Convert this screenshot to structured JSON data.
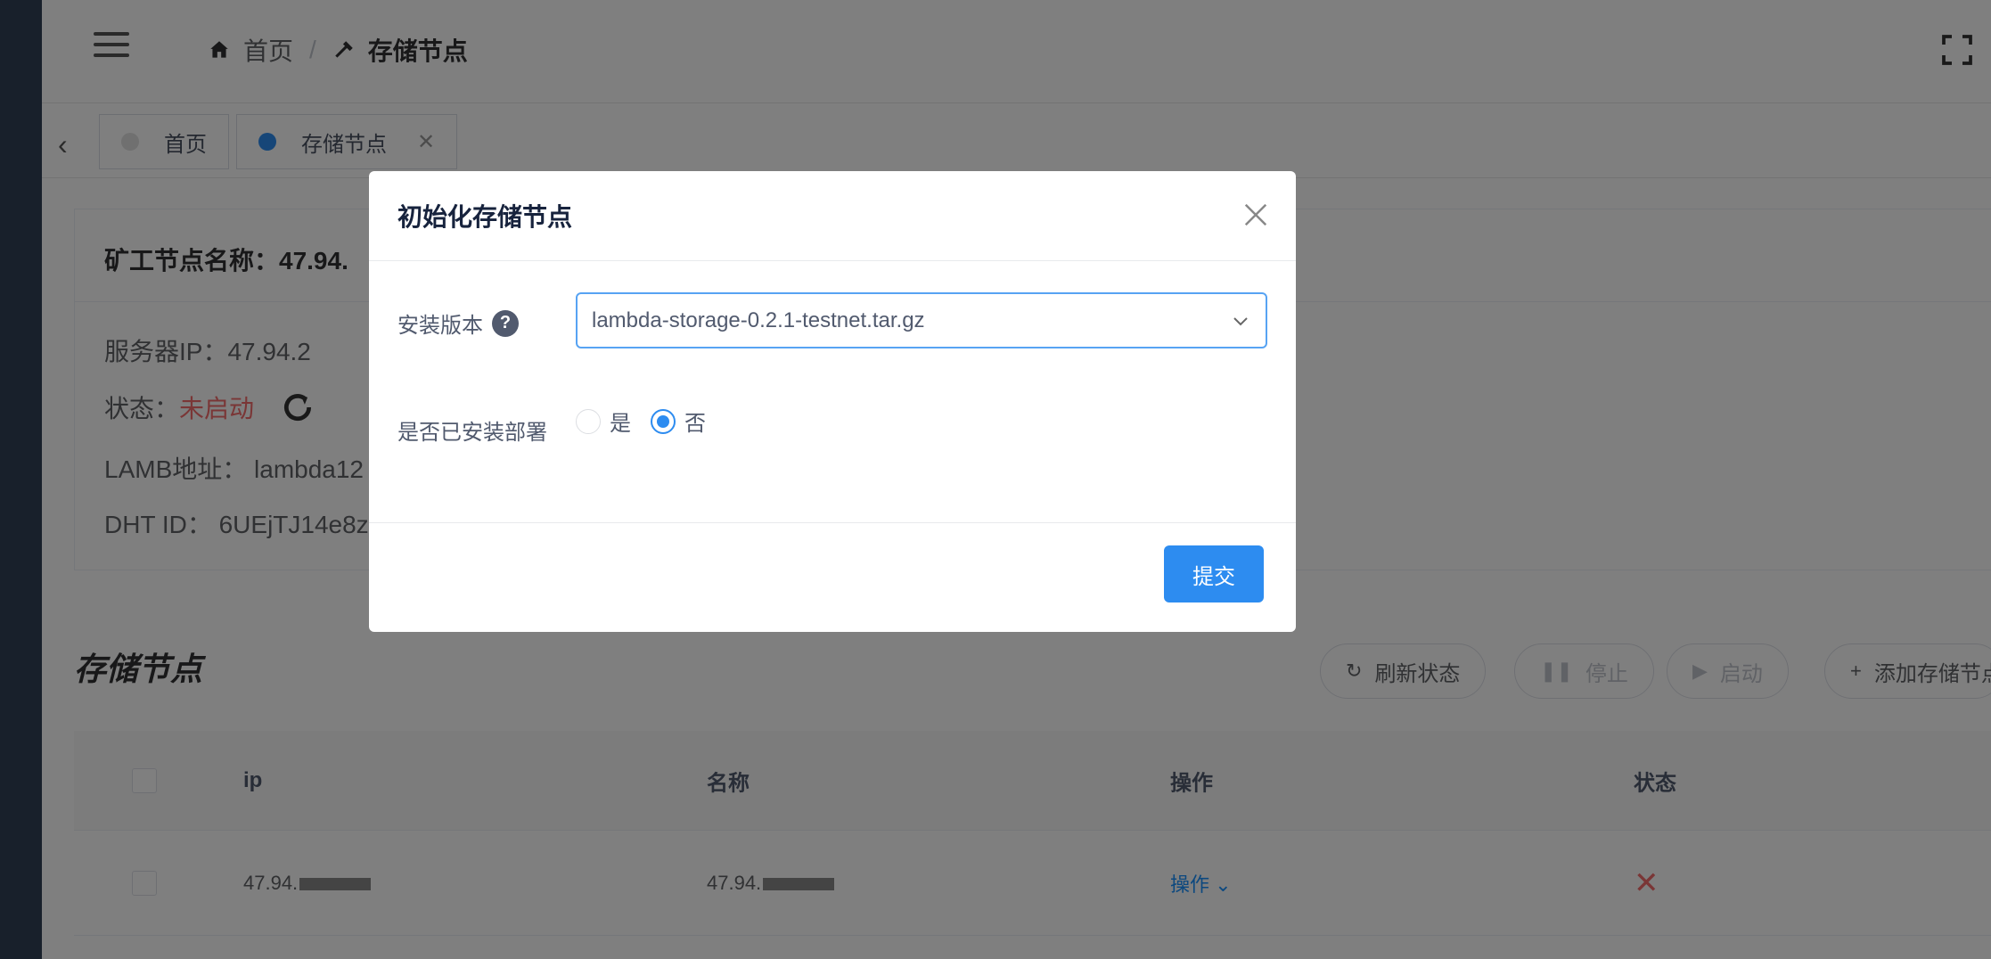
{
  "breadcrumb": {
    "home": "首页",
    "current": "存储节点"
  },
  "tags": [
    {
      "label": "首页"
    },
    {
      "label": "存储节点"
    }
  ],
  "info": {
    "title": "矿工节点名称：47.94.",
    "server_ip": "服务器IP：47.94.2",
    "status_label": "状态：",
    "status_value": "未启动",
    "lamb_address": "LAMB地址： lambda12",
    "dht_id": "DHT ID： 6UEjTJ14e8z"
  },
  "section": {
    "title": "存储节点"
  },
  "actions": {
    "refresh": "刷新状态",
    "stop": "停止",
    "start": "启动",
    "add": "添加存储节点"
  },
  "table": {
    "headers": {
      "ip": "ip",
      "name": "名称",
      "ops": "操作",
      "status": "状态"
    },
    "rows": [
      {
        "ip": "47.94.",
        "name": "47.94.",
        "ops": "操作",
        "status": "✕"
      }
    ]
  },
  "dialog": {
    "title": "初始化存储节点",
    "version_label": "安装版本",
    "version_value": "lambda-storage-0.2.1-testnet.tar.gz",
    "installed_label": "是否已安装部署",
    "opt_yes": "是",
    "opt_no": "否",
    "selected": "否",
    "submit": "提交"
  },
  "colors": {
    "sidebar": "#304156",
    "primary": "#2d8cf0",
    "danger": "#f56c6c"
  }
}
